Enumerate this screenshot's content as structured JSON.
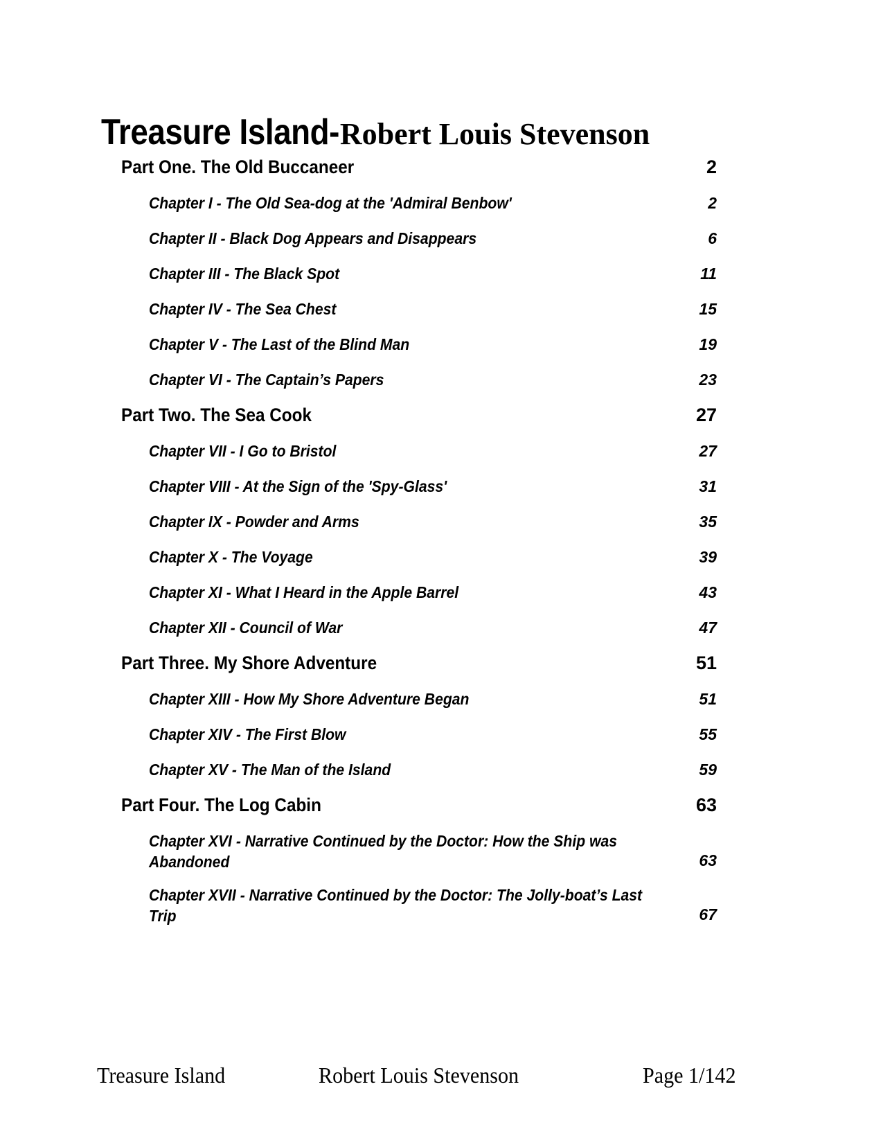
{
  "title": {
    "book": "Treasure Island-",
    "author": "Robert Louis Stevenson"
  },
  "toc": {
    "entries": [
      {
        "kind": "part",
        "title": "Part One. The Old Buccaneer",
        "page": "2",
        "lines": 1
      },
      {
        "kind": "chapter",
        "title": "Chapter I - The Old Sea-dog at the 'Admiral Benbow'",
        "page": "2",
        "lines": 1
      },
      {
        "kind": "chapter",
        "title": "Chapter II - Black Dog Appears and Disappears",
        "page": "6",
        "lines": 1
      },
      {
        "kind": "chapter",
        "title": "Chapter III - The Black Spot",
        "page": "11",
        "lines": 1
      },
      {
        "kind": "chapter",
        "title": "Chapter IV - The Sea Chest",
        "page": "15",
        "lines": 1
      },
      {
        "kind": "chapter",
        "title": "Chapter V - The Last of the Blind Man",
        "page": "19",
        "lines": 1
      },
      {
        "kind": "chapter",
        "title": "Chapter VI - The Captain’s Papers",
        "page": "23",
        "lines": 1
      },
      {
        "kind": "part",
        "title": "Part Two. The Sea Cook",
        "page": "27",
        "lines": 1
      },
      {
        "kind": "chapter",
        "title": "Chapter VII - I Go to Bristol",
        "page": "27",
        "lines": 1
      },
      {
        "kind": "chapter",
        "title": "Chapter VIII - At the Sign of the 'Spy-Glass'",
        "page": "31",
        "lines": 1
      },
      {
        "kind": "chapter",
        "title": "Chapter IX - Powder and Arms",
        "page": "35",
        "lines": 1
      },
      {
        "kind": "chapter",
        "title": "Chapter X - The Voyage",
        "page": "39",
        "lines": 1
      },
      {
        "kind": "chapter",
        "title": "Chapter XI - What I Heard in the Apple Barrel",
        "page": "43",
        "lines": 1
      },
      {
        "kind": "chapter",
        "title": "Chapter XII - Council of War",
        "page": "47",
        "lines": 1
      },
      {
        "kind": "part",
        "title": "Part Three. My Shore Adventure",
        "page": "51",
        "lines": 1
      },
      {
        "kind": "chapter",
        "title": "Chapter XIII - How My Shore Adventure Began",
        "page": "51",
        "lines": 1
      },
      {
        "kind": "chapter",
        "title": "Chapter XIV - The First Blow",
        "page": "55",
        "lines": 1
      },
      {
        "kind": "chapter",
        "title": "Chapter XV - The Man of the Island",
        "page": "59",
        "lines": 1
      },
      {
        "kind": "part",
        "title": "Part Four. The Log Cabin",
        "page": "63",
        "lines": 1
      },
      {
        "kind": "chapter",
        "title": "Chapter XVI - Narrative Continued by the Doctor: How the Ship was Abandoned",
        "page": "63",
        "lines": 2
      },
      {
        "kind": "chapter",
        "title": "Chapter XVII - Narrative Continued by the Doctor: The Jolly-boat’s Last Trip",
        "page": "67",
        "lines": 2
      }
    ]
  },
  "footer": {
    "left": "Treasure Island",
    "center": "Robert Louis Stevenson",
    "right": "Page 1/142"
  }
}
